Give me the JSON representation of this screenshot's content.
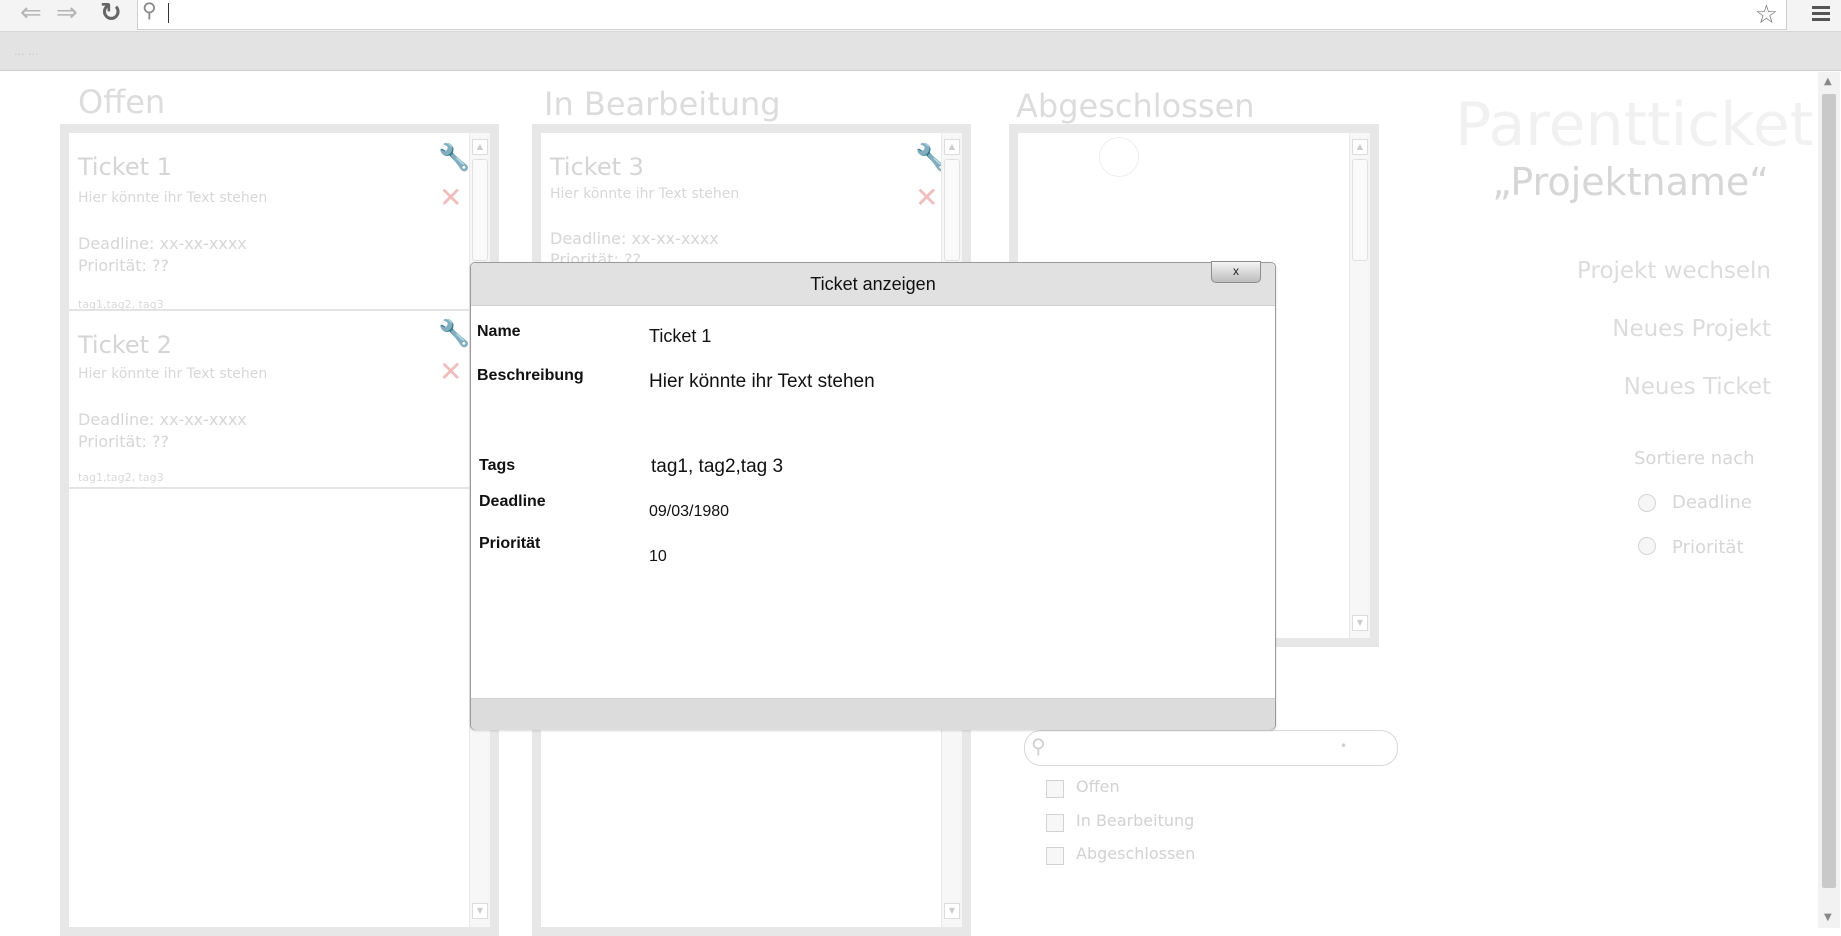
{
  "browser": {
    "back_icon": "back-arrow-icon",
    "forward_icon": "forward-arrow-icon",
    "reload_icon": "reload-icon",
    "address_value": "",
    "bookmark_text": "... ..."
  },
  "columns": {
    "open": {
      "title": "Offen",
      "tickets": [
        {
          "title": "Ticket 1",
          "desc": "Hier könnte ihr Text stehen",
          "deadline": "Deadline: xx-xx-xxxx",
          "priority": "Priorität: ??",
          "tags": "tag1,tag2, tag3"
        },
        {
          "title": "Ticket 2",
          "desc": "Hier könnte ihr Text stehen",
          "deadline": "Deadline: xx-xx-xxxx",
          "priority": "Priorität: ??",
          "tags": "tag1,tag2, tag3"
        }
      ]
    },
    "progress": {
      "title": "In Bearbeitung",
      "tickets": [
        {
          "title": "Ticket 3",
          "desc": "Hier könnte ihr Text stehen",
          "deadline": "Deadline: xx-xx-xxxx",
          "priority": "Priorität: ??"
        }
      ]
    },
    "done": {
      "title": "Abgeschlossen"
    }
  },
  "sidebar": {
    "title": "Parentticket",
    "project": "„Projektname“",
    "links": [
      "Projekt wechseln",
      "Neues Projekt",
      "Neues Ticket"
    ],
    "sort_label": "Sortiere nach",
    "sort_options": [
      "Deadline",
      "Priorität"
    ]
  },
  "filter": {
    "search_placeholder": "",
    "options": [
      "Offen",
      "In Bearbeitung",
      "Abgeschlossen"
    ]
  },
  "modal": {
    "title": "Ticket anzeigen",
    "close": "x",
    "fields": {
      "name_label": "Name",
      "name_value": "Ticket 1",
      "desc_label": "Beschreibung",
      "desc_value": "Hier könnte ihr Text stehen",
      "tags_label": "Tags",
      "tags_value": "tag1, tag2,tag 3",
      "deadline_label": "Deadline",
      "deadline_value": "09/03/1980",
      "priority_label": "Priorität",
      "priority_value": "10"
    }
  }
}
